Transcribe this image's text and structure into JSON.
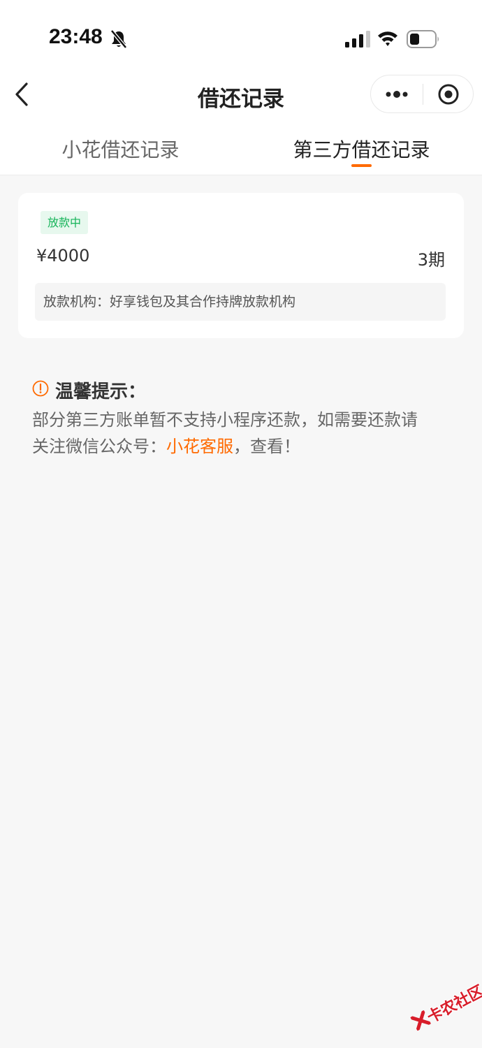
{
  "status_bar": {
    "time": "23:48",
    "icons": [
      "bell-mute-icon",
      "signal-icon",
      "wifi-icon",
      "battery-icon"
    ]
  },
  "nav": {
    "title": "借还记录",
    "back_icon": "chevron-left-icon",
    "capsule_icons": [
      "more-dots-icon",
      "target-close-icon"
    ]
  },
  "tabs": [
    {
      "label": "小花借还记录",
      "active": false
    },
    {
      "label": "第三方借还记录",
      "active": true
    }
  ],
  "record": {
    "status": "放款中",
    "amount": "¥4000",
    "period": "3期",
    "lender": "放款机构：好享钱包及其合作持牌放款机构"
  },
  "tip": {
    "icon": "warning-icon",
    "title": "温馨提示：",
    "line1": "部分第三方账单暂不支持小程序还款，如需要还款请",
    "line2_prefix": "关注微信公众号：",
    "link": "小花客服",
    "line2_suffix": "，查看！"
  },
  "watermark": {
    "text": "卡农社区"
  },
  "colors": {
    "accent": "#ff6a00",
    "badge_text": "#17b45a",
    "badge_bg": "#e7f8ee",
    "background": "#f7f7f7",
    "watermark": "#d81d2a"
  }
}
